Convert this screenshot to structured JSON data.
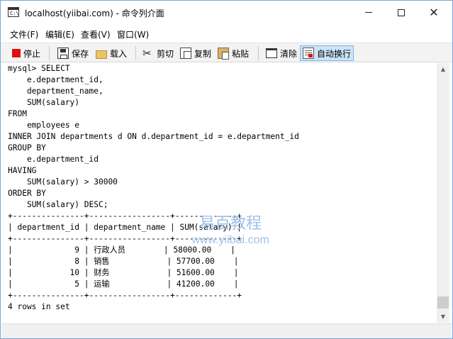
{
  "window": {
    "title": "localhost(yiibai.com) - 命令列介面",
    "icon_name": "console-icon",
    "icon_glyph": "C:\\",
    "controls": {
      "minimize": "minimize-icon",
      "maximize": "maximize-icon",
      "close": "close-icon",
      "close_glyph": "✕"
    }
  },
  "menu": [
    "文件(F)",
    "编辑(E)",
    "查看(V)",
    "窗口(W)"
  ],
  "toolbar": {
    "stop": "停止",
    "save": "保存",
    "load": "载入",
    "cut": "剪切",
    "cut_glyph": "✂",
    "copy": "复制",
    "paste": "粘贴",
    "clear": "清除",
    "wrap": "自动换行",
    "wrap_active": true,
    "colors": {
      "stop_icon": "#e01010",
      "active_bg": "#cce4f7"
    }
  },
  "console": {
    "lines": [
      "mysql> SELECT",
      "    e.department_id,",
      "    department_name,",
      "    SUM(salary)",
      "FROM",
      "    employees e",
      "INNER JOIN departments d ON d.department_id = e.department_id",
      "GROUP BY",
      "    e.department_id",
      "HAVING",
      "    SUM(salary) > 30000",
      "ORDER BY",
      "    SUM(salary) DESC;",
      "+---------------+-----------------+-------------+",
      "| department_id | department_name | SUM(salary) |",
      "+---------------+-----------------+-------------+",
      "|             9 | 行政人员        | 58000.00    |",
      "|             8 | 销售            | 57700.00    |",
      "|            10 | 财务            | 51600.00    |",
      "|             5 | 运输            | 41200.00    |",
      "+---------------+-----------------+-------------+",
      "4 rows in set"
    ]
  },
  "watermark": {
    "title": "易百教程",
    "url": "www.yiibai.com"
  },
  "scrollbar": {
    "up": "▲",
    "down": "▼"
  }
}
